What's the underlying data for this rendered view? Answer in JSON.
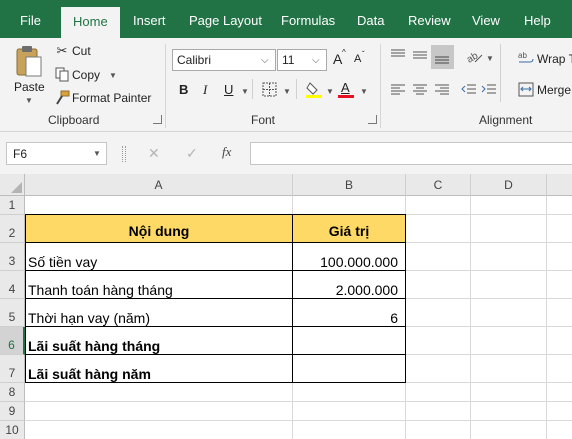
{
  "menu": {
    "tabs": [
      "File",
      "Home",
      "Insert",
      "Page Layout",
      "Formulas",
      "Data",
      "Review",
      "View",
      "Help"
    ]
  },
  "ribbon": {
    "clipboard": {
      "paste": "Paste",
      "cut": "Cut",
      "copy": "Copy",
      "format_painter": "Format Painter",
      "label": "Clipboard"
    },
    "font": {
      "font_name": "Calibri",
      "font_size": "11",
      "bold": "B",
      "italic": "I",
      "underline": "U",
      "label": "Font",
      "grow": "A",
      "shrink": "A",
      "font_color_letter": "A"
    },
    "alignment": {
      "wrap_text": "Wrap T",
      "merge": "Merge",
      "label": "Alignment"
    }
  },
  "formula_bar": {
    "name_box": "F6",
    "fx": "fx",
    "cancel": "✕",
    "enter": "✓",
    "content": ""
  },
  "sheet": {
    "columns": [
      "A",
      "B",
      "C",
      "D"
    ],
    "rows": [
      "1",
      "2",
      "3",
      "4",
      "5",
      "6",
      "7",
      "8",
      "9",
      "10"
    ],
    "header_a": "Nội dung",
    "header_b": "Giá trị",
    "r3a": "Số tiền vay",
    "r3b": "100.000.000",
    "r4a": "Thanh toán hàng tháng",
    "r4b": "2.000.000",
    "r5a": "Thời hạn vay (năm)",
    "r5b": "6",
    "r6a": "Lãi suất hàng tháng",
    "r6b": "",
    "r7a": "Lãi suất hàng năm",
    "r7b": "",
    "header_fill": "#ffd966"
  }
}
